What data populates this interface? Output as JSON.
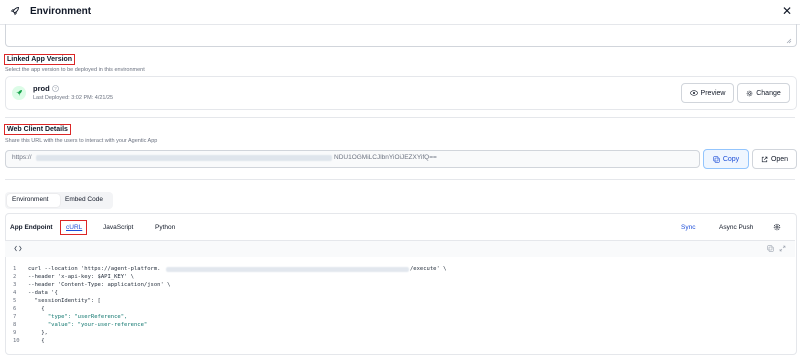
{
  "header": {
    "title": "Environment",
    "close_glyph": "✕",
    "icon": "rocket-icon"
  },
  "linked": {
    "label": "Linked App Version",
    "subtitle": "Select the app version to be deployed in this environment",
    "version_name": "prod",
    "last_deployed": "Last Deployed: 3:02 PM: 4/21/25",
    "preview_label": "Preview",
    "change_label": "Change"
  },
  "web": {
    "label": "Web Client Details",
    "subtitle": "Share this URL with the users to interact with your Agentic App",
    "url_prefix": "https://",
    "url_suffix": "NDU1OGMiLCJlbnYiOiJEZXYifQ==",
    "copy_label": "Copy",
    "open_label": "Open"
  },
  "tabs": {
    "environment": "Environment",
    "embed": "Embed Code"
  },
  "endpoint": {
    "label": "App Endpoint",
    "lang_tabs": [
      "cURL",
      "JavaScript",
      "Python"
    ],
    "sync": "Sync",
    "async": "Async Push"
  },
  "code": {
    "line_numbers": [
      "1",
      "2",
      "3",
      "4",
      "5",
      "6",
      "7",
      "8",
      "9",
      "10"
    ],
    "lines": [
      "curl --location 'https://agent-platform.",
      "--header 'x-api-key: $API_KEY' \\",
      "--header 'Content-Type: application/json' \\",
      "--data '{",
      "  \"sessionIdentity\": [",
      "    {",
      "      \"type\": \"userReference\",",
      "      \"value\": \"your-user-reference\"",
      "    },",
      "    {"
    ],
    "line1_suffix": "/execute' \\"
  },
  "colors": {
    "accent": "#1d4ed8",
    "highlight_border": "#dc2626",
    "rocket_green": "#16a34a"
  }
}
